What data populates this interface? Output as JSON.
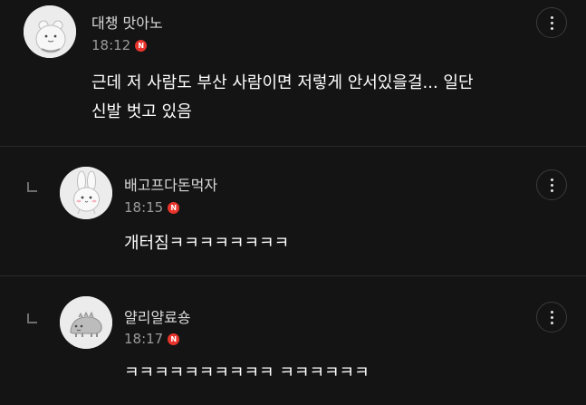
{
  "comments": [
    {
      "nickname": "대챙 맛아노",
      "time": "18:12",
      "badge": "N",
      "text": "근데 저 사람도 부산 사람이면 저렇게 안서있을걸... 일단\n신발 벗고 있음",
      "avatar_icon": "white-bear-avatar-icon"
    },
    {
      "nickname": "배고프다돈먹자",
      "time": "18:15",
      "badge": "N",
      "text": "개터짐ㅋㅋㅋㅋㅋㅋㅋㅋ",
      "avatar_icon": "rabbit-avatar-icon"
    },
    {
      "nickname": "얄리얄료숑",
      "time": "18:17",
      "badge": "N",
      "text": "ㅋㅋㅋㅋㅋㅋㅋㅋㅋㅋ ㅋㅋㅋㅋㅋㅋ",
      "avatar_icon": "dinosaur-avatar-icon"
    }
  ],
  "colors": {
    "background": "#141414",
    "badge": "#e8342c",
    "nickname": "#d9d9d9",
    "time": "#9a9a9a"
  }
}
